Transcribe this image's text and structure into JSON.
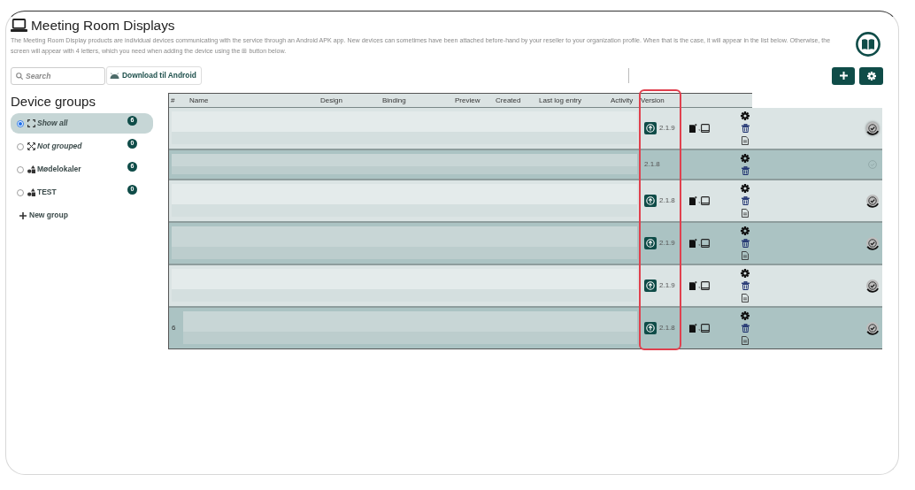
{
  "page": {
    "title": "Meeting Room Displays",
    "description": "The Meeting Room Display products are individual devices communicating with the service through an Android APK app. New devices can sometimes have been attached before-hand by your reseller to your organization profile. When that is the case, it will appear in the list below. Otherwise, the screen will appear with 4 letters, which you need when adding the device using the ⊞ button below."
  },
  "toolbar": {
    "search": {
      "placeholder": "Search"
    },
    "download_button": "Download til Android"
  },
  "device_groups": {
    "title": "Device groups",
    "items": [
      {
        "kind": "all",
        "label": "Show all",
        "count": "6",
        "selected": true
      },
      {
        "kind": "ungrouped",
        "label": "Not grouped",
        "count": "0",
        "selected": false
      },
      {
        "kind": "group",
        "label": "Mødelokaler",
        "count": "6",
        "selected": false
      },
      {
        "kind": "group",
        "label": "TEST",
        "count": "0",
        "selected": false
      }
    ],
    "new_group": "New group"
  },
  "table": {
    "columns": [
      {
        "label": "#",
        "highlighted": false
      },
      {
        "label": "Name",
        "highlighted": false
      },
      {
        "label": "Design",
        "highlighted": false
      },
      {
        "label": "Binding",
        "highlighted": false
      },
      {
        "label": "Preview",
        "highlighted": false
      },
      {
        "label": "Created",
        "highlighted": false
      },
      {
        "label": "Last log entry",
        "highlighted": false
      },
      {
        "label": "Activity",
        "highlighted": false
      },
      {
        "label": "Version",
        "highlighted": true
      }
    ],
    "rows": [
      {
        "version": "2.1.9",
        "update_available": true,
        "device_icons": true,
        "separator": ",",
        "has_log": true,
        "active": true
      },
      {
        "version": "2.1.8",
        "update_available": false,
        "device_icons": false,
        "has_log": false,
        "active": false
      },
      {
        "version": "2.1.8",
        "update_available": true,
        "device_icons": true,
        "separator": ",",
        "has_log": true,
        "active": true
      },
      {
        "version": "2.1.9",
        "update_available": true,
        "device_icons": true,
        "separator": ",",
        "has_log": true,
        "active": true
      },
      {
        "version": "2.1.9",
        "update_available": true,
        "device_icons": true,
        "separator": ",",
        "has_log": true,
        "active": true
      },
      {
        "number": "6",
        "version": "2.1.8",
        "update_available": true,
        "device_icons": true,
        "separator": ",",
        "has_log": true,
        "active": true
      }
    ]
  }
}
